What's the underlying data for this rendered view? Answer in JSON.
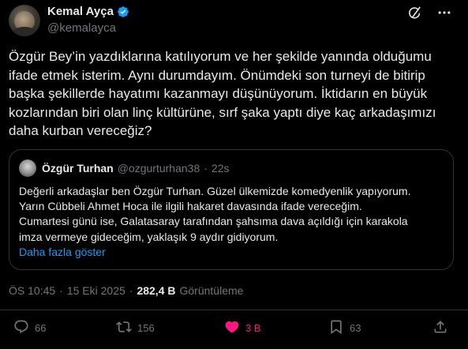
{
  "author": {
    "name": "Kemal Ayça",
    "handle": "@kemalayca",
    "verified": true
  },
  "icons": {
    "grok": "grok-icon",
    "more": "more-options-icon",
    "verified": "verified-badge-icon",
    "reply": "reply-icon",
    "retweet": "retweet-icon",
    "like": "heart-icon",
    "bookmark": "bookmark-icon",
    "share": "share-icon"
  },
  "tweet": {
    "text": "Özgür Bey’in yazdıklarına katılıyorum ve her şekilde yanında olduğumu\nifade etmek isterim. Aynı durumdayım. Önümdeki son turneyi de bitirip\nbaşka şekillerde hayatımı kazanmayı düşünüyorum. İktidarın en büyük\nkozlarından biri olan linç kültürüne, sırf şaka yaptı diye kaç arkadaşımızı\ndaha kurban vereceğiz?"
  },
  "quote": {
    "name": "Özgür Turhan",
    "handle": "@ozgurturhan38",
    "separator": "·",
    "time": "22s",
    "text": "Değerli arkadaşlar ben Özgür Turhan. Güzel ülkemizde komedyenlik yapıyorum.\nYarın Cübbeli Ahmet Hoca ile ilgili hakaret davasında ifade vereceğim.\nCumartesi günü ise, Galatasaray tarafından şahsıma dava açıldığı için karakola\nimza vermeye gideceğim, yaklaşık 9 aydır gidiyorum.",
    "show_more": "Daha fazla göster"
  },
  "meta": {
    "time": "ÖS 10:45",
    "separator1": "·",
    "date": "15 Eki 2025",
    "separator2": "·",
    "views": "282,4 B",
    "views_label": "Görüntüleme"
  },
  "actions": {
    "replies": "66",
    "retweets": "156",
    "likes": "3 B",
    "bookmarks": "63"
  },
  "colors": {
    "background": "#000000",
    "text": "#e7e9ea",
    "muted": "#71767b",
    "link": "#1d9bf0",
    "like": "#f91880",
    "border": "#2f3336",
    "verified": "#1d9bf0"
  }
}
